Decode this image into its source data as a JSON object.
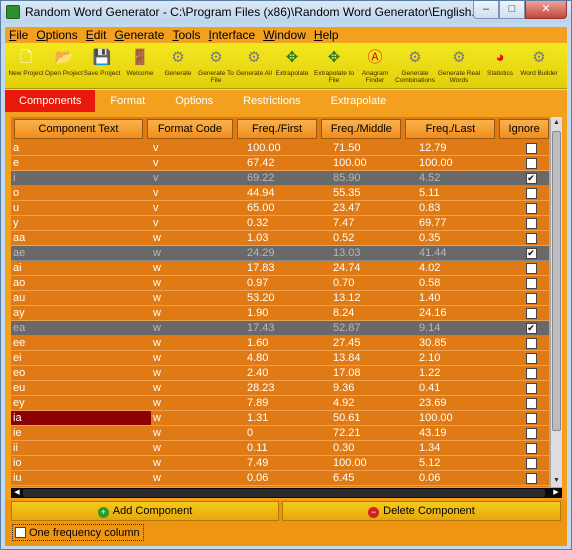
{
  "window": {
    "title": "Random Word Generator - C:\\Program Files (x86)\\Random Word Generator\\English.rwg",
    "controls": {
      "minimize": "–",
      "maximize": "□",
      "close": "✕"
    }
  },
  "menu": [
    "File",
    "Options",
    "Edit",
    "Generate",
    "Tools",
    "Interface",
    "Window",
    "Help"
  ],
  "toolbar": [
    {
      "label": "New Project",
      "icon": "new-page-icon"
    },
    {
      "label": "Open Project",
      "icon": "open-folder-icon"
    },
    {
      "label": "Save Project",
      "icon": "floppy-icon"
    },
    {
      "label": "Welcome",
      "icon": "door-icon"
    },
    {
      "label": "Generate",
      "icon": "gear-icon"
    },
    {
      "label": "Generate To File",
      "icon": "gear-file-icon"
    },
    {
      "label": "Generate All",
      "icon": "gears-icon"
    },
    {
      "label": "Extrapolate",
      "icon": "arrows-icon"
    },
    {
      "label": "Extrapolate to File",
      "icon": "arrows-file-icon"
    },
    {
      "label": "Anagram Finder",
      "icon": "anagram-icon"
    },
    {
      "label": "Generate Combinations",
      "icon": "combination-icon"
    },
    {
      "label": "Generate Real Words",
      "icon": "real-words-icon"
    },
    {
      "label": "Statistics",
      "icon": "pie-chart-icon"
    },
    {
      "label": "Word Builder",
      "icon": "builder-icon"
    }
  ],
  "tabs": [
    "Components",
    "Format",
    "Options",
    "Restrictions",
    "Extrapolate"
  ],
  "active_tab": "Components",
  "table": {
    "headers": [
      "Component Text",
      "Format Code",
      "Freq./First",
      "Freq./Middle",
      "Freq./Last",
      "Ignore"
    ],
    "rows": [
      {
        "text": "a",
        "code": "v",
        "first": "100.00",
        "middle": "71.50",
        "last": "12.79",
        "ignore": false
      },
      {
        "text": "e",
        "code": "v",
        "first": "67.42",
        "middle": "100.00",
        "last": "100.00",
        "ignore": false
      },
      {
        "text": "i",
        "code": "v",
        "first": "69.22",
        "middle": "85.90",
        "last": "4.52",
        "ignore": true
      },
      {
        "text": "o",
        "code": "v",
        "first": "44.94",
        "middle": "55.35",
        "last": "5.11",
        "ignore": false
      },
      {
        "text": "u",
        "code": "v",
        "first": "65.00",
        "middle": "23.47",
        "last": "0.83",
        "ignore": false
      },
      {
        "text": "y",
        "code": "v",
        "first": "0.32",
        "middle": "7.47",
        "last": "69.77",
        "ignore": false
      },
      {
        "text": "aa",
        "code": "w",
        "first": "1.03",
        "middle": "0.52",
        "last": "0.35",
        "ignore": false
      },
      {
        "text": "ae",
        "code": "w",
        "first": "24.29",
        "middle": "13.03",
        "last": "41.44",
        "ignore": true
      },
      {
        "text": "ai",
        "code": "w",
        "first": "17.83",
        "middle": "24.74",
        "last": "4.02",
        "ignore": false
      },
      {
        "text": "ao",
        "code": "w",
        "first": "0.97",
        "middle": "0.70",
        "last": "0.58",
        "ignore": false
      },
      {
        "text": "au",
        "code": "w",
        "first": "53.20",
        "middle": "13.12",
        "last": "1.40",
        "ignore": false
      },
      {
        "text": "ay",
        "code": "w",
        "first": "1.90",
        "middle": "8.24",
        "last": "24.16",
        "ignore": false
      },
      {
        "text": "ea",
        "code": "w",
        "first": "17.43",
        "middle": "52.87",
        "last": "9.14",
        "ignore": true
      },
      {
        "text": "ee",
        "code": "w",
        "first": "1.60",
        "middle": "27.45",
        "last": "30.85",
        "ignore": false
      },
      {
        "text": "ei",
        "code": "w",
        "first": "4.80",
        "middle": "13.84",
        "last": "2.10",
        "ignore": false
      },
      {
        "text": "eo",
        "code": "w",
        "first": "2.40",
        "middle": "17.08",
        "last": "1.22",
        "ignore": false
      },
      {
        "text": "eu",
        "code": "w",
        "first": "28.23",
        "middle": "9.36",
        "last": "0.41",
        "ignore": false
      },
      {
        "text": "ey",
        "code": "w",
        "first": "7.89",
        "middle": "4.92",
        "last": "23.69",
        "ignore": false
      },
      {
        "text": "ia",
        "code": "w",
        "first": "1.31",
        "middle": "50.61",
        "last": "100.00",
        "ignore": false,
        "editing": true
      },
      {
        "text": "ie",
        "code": "w",
        "first": "0",
        "middle": "72.21",
        "last": "43.19",
        "ignore": false
      },
      {
        "text": "ii",
        "code": "w",
        "first": "0.11",
        "middle": "0.30",
        "last": "1.34",
        "ignore": false
      },
      {
        "text": "io",
        "code": "w",
        "first": "7.49",
        "middle": "100.00",
        "last": "5.12",
        "ignore": false
      },
      {
        "text": "iu",
        "code": "w",
        "first": "0.06",
        "middle": "6.45",
        "last": "0.06",
        "ignore": false
      }
    ]
  },
  "buttons": {
    "add": "Add Component",
    "delete": "Delete Component"
  },
  "one_frequency": {
    "label": "One frequency column",
    "checked": false
  },
  "colors": {
    "orange": "#f2a01d",
    "grid": "#e07a14",
    "tab_active": "#e8190b",
    "toolbar": "#f4e81f"
  }
}
